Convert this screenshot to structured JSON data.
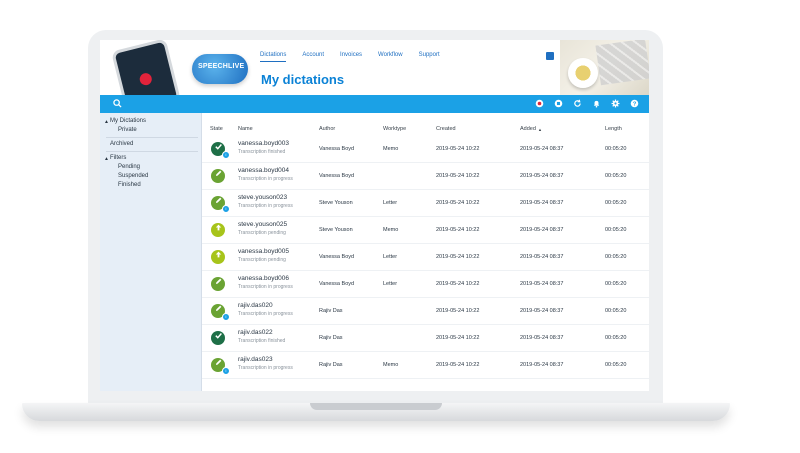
{
  "header": {
    "logo_text": "SPEECHLIVE",
    "title": "My dictations",
    "nav": [
      "Dictations",
      "Account",
      "Invoices",
      "Workflow",
      "Support"
    ]
  },
  "colors": {
    "accent": "#1ba1e6",
    "title": "#0b82d6",
    "state_finished": "#1e6f47",
    "state_progress": "#6aa333",
    "state_pending": "#a7c41a"
  },
  "toolbar": {
    "icons": [
      "search-icon",
      "record-icon",
      "stop-icon",
      "refresh-icon",
      "bell-icon",
      "gear-icon",
      "help-icon"
    ]
  },
  "sidebar": {
    "my_dictations": "My Dictations",
    "private": "Private",
    "archived": "Archived",
    "filters": "Filters",
    "pending": "Pending",
    "suspended": "Suspended",
    "finished": "Finished"
  },
  "table": {
    "headers": {
      "state": "State",
      "name": "Name",
      "author": "Author",
      "worktype": "Worktype",
      "created": "Created",
      "added": "Added",
      "length": "Length"
    },
    "sort_indicator": "▲",
    "rows": [
      {
        "state": "finished",
        "name": "vanessa.boyd003",
        "status": "Transcription finished",
        "author": "Vanessa Boyd",
        "worktype": "Memo",
        "created": "2019-05-24  10:22",
        "added": "2019-05-24  08:37",
        "length": "00:05:20",
        "info": true
      },
      {
        "state": "progress",
        "name": "vanessa.boyd004",
        "status": "Transcription in progress",
        "author": "Vanessa Boyd",
        "worktype": "",
        "created": "2019-05-24  10:22",
        "added": "2019-05-24  08:37",
        "length": "00:05:20",
        "info": false
      },
      {
        "state": "progress",
        "name": "steve.youson023",
        "status": "Transcription in progress",
        "author": "Steve Youson",
        "worktype": "Letter",
        "created": "2019-05-24  10:22",
        "added": "2019-05-24  08:37",
        "length": "00:05:20",
        "info": true
      },
      {
        "state": "pending",
        "name": "steve.youson025",
        "status": "Transcription pending",
        "author": "Steve Youson",
        "worktype": "Memo",
        "created": "2019-05-24  10:22",
        "added": "2019-05-24  08:37",
        "length": "00:05:20",
        "info": false
      },
      {
        "state": "pending",
        "name": "vanessa.boyd005",
        "status": "Transcription pending",
        "author": "Vanessa Boyd",
        "worktype": "Letter",
        "created": "2019-05-24  10:22",
        "added": "2019-05-24  08:37",
        "length": "00:05:20",
        "info": false
      },
      {
        "state": "progress",
        "name": "vanessa.boyd006",
        "status": "Transcription in progress",
        "author": "Vanessa Boyd",
        "worktype": "Letter",
        "created": "2019-05-24  10:22",
        "added": "2019-05-24  08:37",
        "length": "00:05:20",
        "info": false
      },
      {
        "state": "progress",
        "name": "rajiv.das020",
        "status": "Transcription in progress",
        "author": "Rajiv Das",
        "worktype": "",
        "created": "2019-05-24  10:22",
        "added": "2019-05-24  08:37",
        "length": "00:05:20",
        "info": true
      },
      {
        "state": "finished",
        "name": "rajiv.das022",
        "status": "Transcription finished",
        "author": "Rajiv Das",
        "worktype": "",
        "created": "2019-05-24  10:22",
        "added": "2019-05-24  08:37",
        "length": "00:05:20",
        "info": false
      },
      {
        "state": "progress",
        "name": "rajiv.das023",
        "status": "Transcription in progress",
        "author": "Rajiv Das",
        "worktype": "Memo",
        "created": "2019-05-24  10:22",
        "added": "2019-05-24  08:37",
        "length": "00:05:20",
        "info": true
      }
    ]
  }
}
